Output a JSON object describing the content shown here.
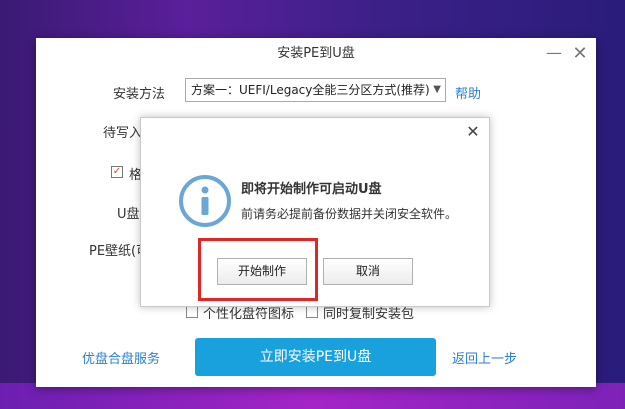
{
  "window": {
    "title": "安装PE到U盘",
    "minimize": "—",
    "close": "✕"
  },
  "form": {
    "install_method_label": "安装方法",
    "install_method_value": "方案一：UEFI/Legacy全能三分区方式(推荐)",
    "help_link": "帮助",
    "target_disk_label": "待写入",
    "format_label": "格",
    "format_checked": true,
    "udisk_label": "U盘",
    "wallpaper_label": "PE壁纸(可",
    "personalize_label": "个性化盘符图标",
    "copy_install_label": "同时复制安装包"
  },
  "footer": {
    "service_link": "优盘合盘服务",
    "install_button": "立即安装PE到U盘",
    "back_link": "返回上一步"
  },
  "dialog": {
    "close": "✕",
    "heading": "即将开始制作可启动U盘",
    "message": "前请务必提前备份数据并关闭安全软件。",
    "start_button": "开始制作",
    "cancel_button": "取消"
  },
  "colors": {
    "accent": "#19a1dd",
    "link": "#2b7fd4",
    "highlight": "#e22626",
    "info_icon": "#6aa6d6"
  },
  "icons": {
    "info": "info-icon",
    "dropdown": "chevron-down-icon",
    "check": "checkmark-icon"
  }
}
